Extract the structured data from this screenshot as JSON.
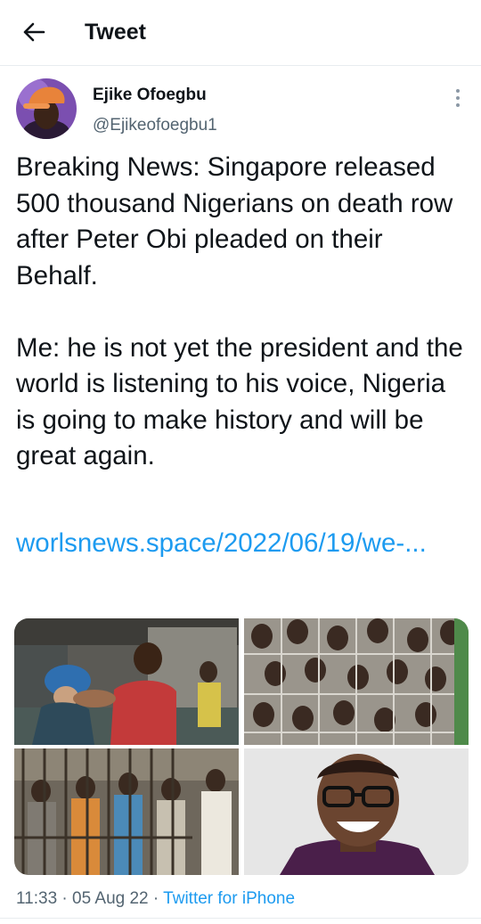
{
  "header": {
    "title": "Tweet",
    "back_icon": "arrow-left-icon"
  },
  "author": {
    "name": "Ejike Ofoegbu",
    "handle": "@Ejikeofoegbu1",
    "avatar_icon": "user-avatar"
  },
  "tweet": {
    "text": "Breaking News: Singapore released 500 thousand Nigerians on death row after Peter Obi pleaded on their Behalf.\n\nMe: he is not yet the president and the world is listening to his voice, Nigeria is going to make history and will be great again.",
    "link_text": "worlsnews.space/2022/06/19/we-...",
    "media_count": 4
  },
  "meta": {
    "time": "11:33",
    "separator": "·",
    "date": "05 Aug 22",
    "source": "Twitter for iPhone"
  },
  "colors": {
    "link": "#1d9bf0",
    "secondary_text": "#536471",
    "primary_text": "#0f1419",
    "divider": "#e8ecef"
  }
}
